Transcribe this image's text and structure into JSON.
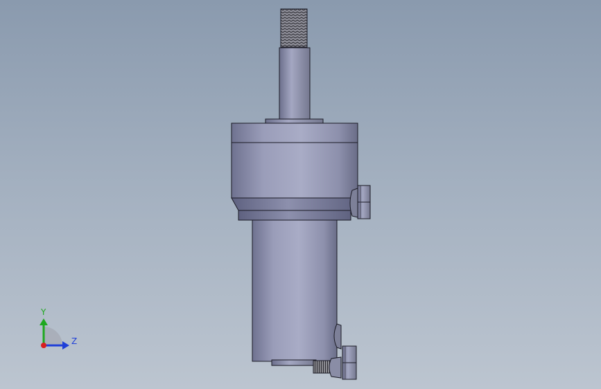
{
  "viewport": {
    "background_top": "#8a9aae",
    "background_bottom": "#bcc5d0"
  },
  "model": {
    "part_color": "#9a9db6",
    "edge_color": "#1a1a24",
    "components": [
      "threaded-rod",
      "piston-rod",
      "cylinder-head",
      "cylinder-body",
      "hex-fitting-upper",
      "hex-fitting-lower",
      "port-fitting-bottom"
    ]
  },
  "triad": {
    "y_label": "Y",
    "z_label": "Z",
    "y_color": "#1fa81f",
    "z_color": "#1f3fd8",
    "x_color": "#d81f1f"
  }
}
